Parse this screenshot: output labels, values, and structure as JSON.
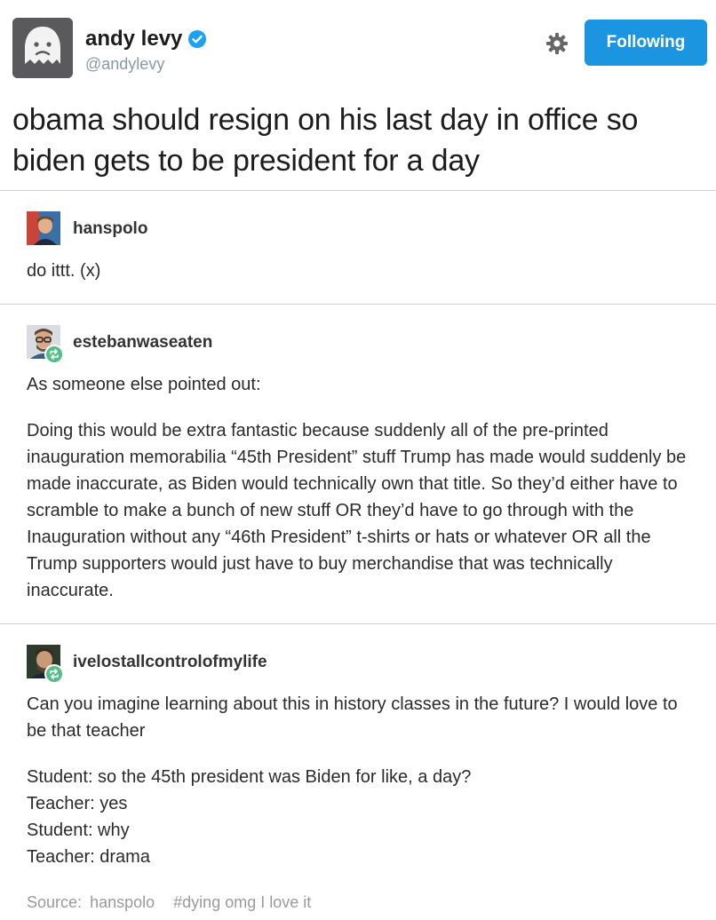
{
  "tweet": {
    "name": "andy levy",
    "handle": "@andylevy",
    "follow_label": "Following",
    "text": "obama should resign on his last day in office so biden gets to be president for a day"
  },
  "posts": [
    {
      "username": "hanspolo",
      "paragraphs": [
        "do ittt.  (x)"
      ]
    },
    {
      "username": "estebanwaseaten",
      "paragraphs": [
        "As someone else pointed out:",
        "Doing this would be extra fantastic because suddenly all of the pre-printed inauguration memorabilia “45th President” stuff Trump has made would suddenly be made inaccurate, as Biden would technically own that title. So they’d either have to scramble to make a bunch of new stuff OR they’d have to go through with the Inauguration without any “46th President” t-shirts or hats or whatever OR all the Trump supporters would just have to buy merchandise that was technically inaccurate."
      ]
    },
    {
      "username": "ivelostallcontrolofmylife",
      "paragraphs": [
        "Can you imagine learning about this in history classes in the future? I would love to be that teacher"
      ],
      "dialogue": [
        "Student: so the 45th president was Biden for like, a day?",
        "Teacher: yes",
        "Student: why",
        "Teacher: drama"
      ]
    }
  ],
  "footer": {
    "source_label": "Source:",
    "source_user": "hanspolo",
    "tags": "#dying omg I love it"
  },
  "colors": {
    "follow_button": "#1b95e0",
    "verified": "#1da1f2",
    "reblog_badge": "#56bc8a",
    "divider": "#cfd3d6"
  },
  "icons": [
    "ghost-avatar-icon",
    "verified-badge-icon",
    "gear-icon",
    "reblog-icon"
  ]
}
